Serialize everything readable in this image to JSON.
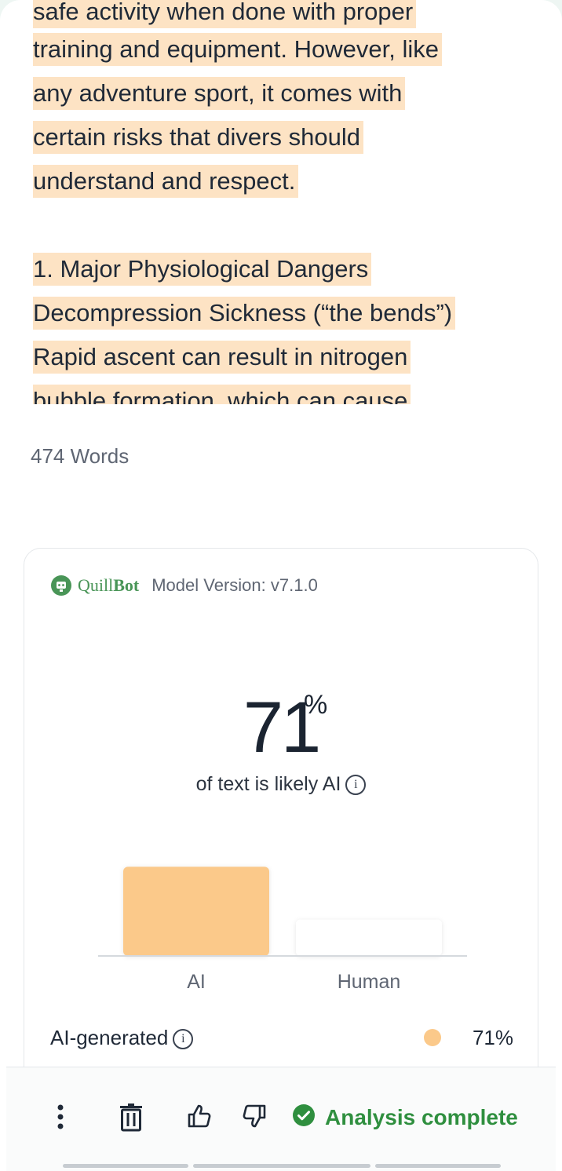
{
  "editor": {
    "lines": [
      "safe activity when done with proper",
      "training and equipment. However, like",
      "any adventure sport, it comes with",
      "certain risks that divers should",
      "understand and respect.",
      "",
      "1. Major Physiological Dangers",
      "Decompression Sickness (“the bends”)",
      "Rapid ascent can result in nitrogen",
      "bubble formation, which can cause"
    ],
    "highlight_color": "#fde3c4"
  },
  "word_count": "474 Words",
  "result": {
    "brand_light": "Quill",
    "brand_bold": "Bot",
    "model_version": "Model Version: v7.1.0",
    "score": "71",
    "score_unit": "%",
    "subtitle": "of text is likely AI",
    "info_icon": "i",
    "ai_row_label": "AI-generated",
    "ai_row_value": "71%",
    "ai_color": "#fbc98a"
  },
  "chart_data": {
    "type": "bar",
    "categories": [
      "AI",
      "Human"
    ],
    "values": [
      71,
      29
    ],
    "ylim": [
      0,
      100
    ],
    "colors": [
      "#fbc98a",
      "#ffffff"
    ]
  },
  "toolbar": {
    "icons": [
      "more-vertical-icon",
      "trash-icon",
      "thumbs-up-icon",
      "thumbs-down-icon"
    ],
    "status": "Analysis complete",
    "status_color": "#2f8f3f"
  }
}
